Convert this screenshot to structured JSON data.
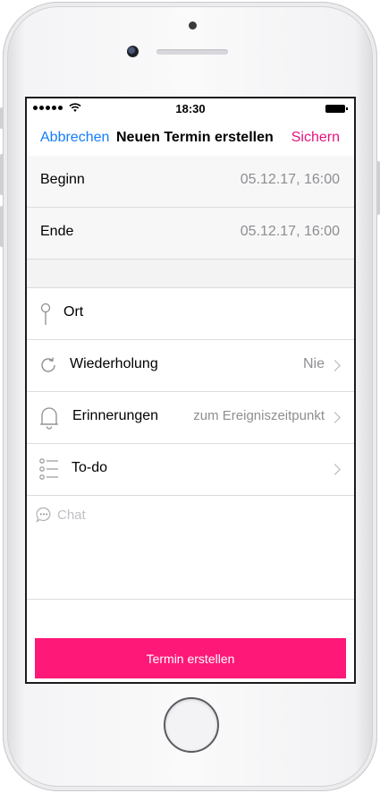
{
  "status_bar": {
    "time": "18:30"
  },
  "nav": {
    "cancel_label": "Abbrechen",
    "title": "Neuen Termin erstellen",
    "save_label": "Sichern"
  },
  "fields": {
    "begin": {
      "label": "Beginn",
      "value": "05.12.17, 16:00"
    },
    "end": {
      "label": "Ende",
      "value": "05.12.17, 16:00"
    },
    "location": {
      "label": "Ort"
    },
    "repeat": {
      "label": "Wiederholung",
      "value": "Nie",
      "icon": "repeat-icon"
    },
    "reminders": {
      "label": "Erinnerungen",
      "value": "zum Ereigniszeitpunkt",
      "icon": "bell-icon"
    },
    "todo": {
      "label": "To-do",
      "icon": "checklist-icon"
    }
  },
  "chat": {
    "label": "Chat",
    "icon": "chat-bubble-icon"
  },
  "cta": {
    "label": "Termin erstellen"
  },
  "colors": {
    "accent_blue": "#147efb",
    "accent_pink": "#e5127d",
    "button_pink": "#fe1878"
  }
}
